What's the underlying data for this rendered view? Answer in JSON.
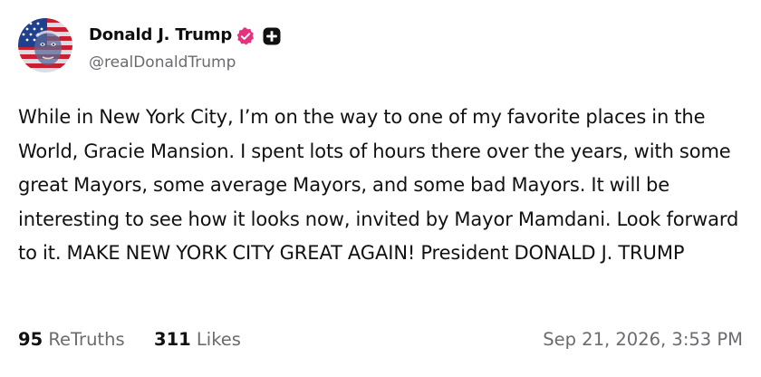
{
  "post": {
    "author": {
      "display_name": "Donald J. Trump",
      "handle": "@realDonaldTrump",
      "avatar_icon": "flag-face-avatar",
      "verified_icon": "verified-badge-icon",
      "verified_color": "#e5327f",
      "extra_badge_icon": "plus-badge-icon"
    },
    "text": "While in New York City, I’m on the way to one of my favorite places in the World, Gracie Mansion. I spent lots of hours there over the years, with some great Mayors, some average Mayors, and some bad Mayors. It will be interesting to see how it looks now, invited by Mayor Mamdani. Look forward to it. MAKE NEW YORK CITY GREAT AGAIN! President DONALD J. TRUMP",
    "stats": {
      "retruths_count": "95",
      "retruths_label": "ReTruths",
      "likes_count": "311",
      "likes_label": "Likes"
    },
    "timestamp": "Sep 21, 2026, 3:53 PM"
  }
}
